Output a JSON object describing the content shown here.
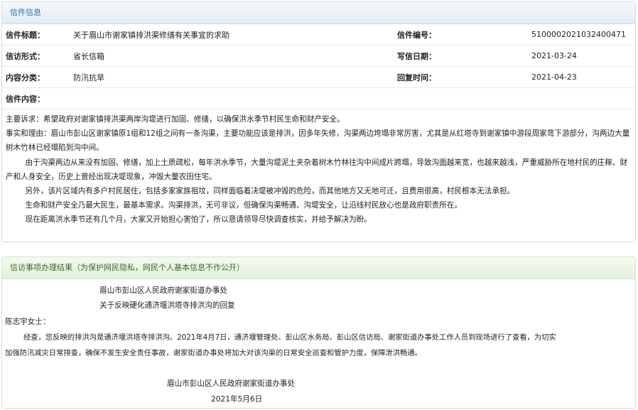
{
  "section1": {
    "title": "信件信息",
    "rows": [
      {
        "k1": "信件标题：",
        "v1": "关于眉山市谢家镇排洪渠修缮有关事宜的求助",
        "k2": "信件编号：",
        "v2": "510000202103240047​1"
      },
      {
        "k1": "信访形式：",
        "v1": "省长信箱",
        "k2": "写信日期：",
        "v2": "2021-03-24"
      },
      {
        "k1": "内容分类：",
        "v1": "防汛抗旱",
        "k2": "回复时间：",
        "v2": "2021-04-23"
      }
    ],
    "content_label": "信件内容：",
    "paragraphs": [
      "主要诉求：希望政府对谢家镇排洪渠两岸沟堤进行加固、修缮，以确保洪水季节村民生命和财产安全。",
      "事实和理由：眉山市彭山区谢家镇原1组和12组之间有一条沟渠，主要功能应该是排洪，因多年失修，沟渠两边垮塌非常厉害，尤其是从红塔寺到谢家镇中游段周家弯下游部分，沟两边大量树木竹林已经塌陷到沟中间。",
      "由于沟渠两边从来没有加固、修缮，加上土质疏松，每年洪水季节，大量沟堤泥土夹杂着树木竹林往沟中间成片跨塌，导致沟面越来宽，也越来越浅，严重威胁所在地村民的庄稼、财产和人身安全，历史上曾经出现决堤现象，冲毁大量农田住宅。",
      "另外，该片区域内有多户村民居住，包括多家家族祖坟，同样面临着决堤被冲毁的危险，而其他地方又无地可迁，且费用很高，村民根本无法承担。",
      "生命和财产安全乃最大民生，最基本需求。沟渠排洪，无可非议，但确保沟渠畅通、沟堤安全，让沿线村民放心也是政府职责所在。",
      "现在距离洪水季节还有几个月，大家又开始担心害怕了，所以恳请领导尽快调查核实，并给予解决为盼。"
    ]
  },
  "section2": {
    "title": "信访事项办理结果（为保护网民隐私，网民个人基本信息不作公开）",
    "org": "眉山市彭山区人民政府谢家街道办事处",
    "subject": "关于反映硬化通济堰洪塔寺排洪沟的回复",
    "salutation": "陈志宇女士：",
    "body_line1": "经查，您反映的排洪沟是通济堰洪塔寺排洪沟。2021年4月7日，通济堰管理处、彭山区水务局、彭山区信访局、谢家街道办事处工作人员到现场进行了查看，为切实",
    "body_line2": "加强防汛减灾日常排查，确保不发生安全责任事故，谢家街道办事处将加大对该沟渠的日常安全巡查和管护力度，保障泄洪畅通。",
    "sign_org": "眉山市彭山区人民政府谢家街道办事处",
    "sign_date": "2021年5月6日"
  }
}
